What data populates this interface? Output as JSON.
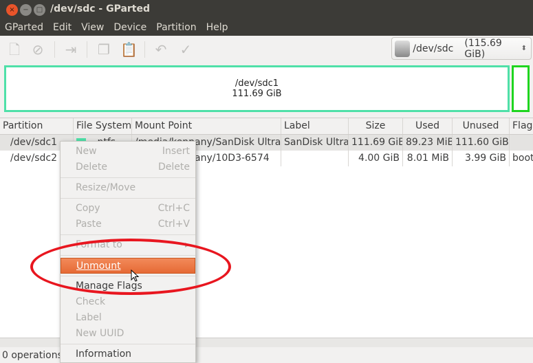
{
  "window": {
    "title": "/dev/sdc - GParted"
  },
  "menubar": [
    "GParted",
    "Edit",
    "View",
    "Device",
    "Partition",
    "Help"
  ],
  "device_selector": {
    "device": "/dev/sdc",
    "size": "(115.69 GiB)"
  },
  "graph": {
    "partition": "/dev/sdc1",
    "size": "111.69 GiB",
    "colors": {
      "ntfs": "#4fe0a8",
      "unallocated_or_sdc2": "#1fd51f"
    }
  },
  "table": {
    "headers": [
      "Partition",
      "File System",
      "Mount Point",
      "Label",
      "Size",
      "Used",
      "Unused",
      "Flags"
    ],
    "rows": [
      {
        "partition": "/dev/sdc1",
        "fs": "ntfs",
        "mount": "/media/kenpany/SanDisk Ultra",
        "label": "SanDisk Ultra",
        "size": "111.69 GiB",
        "used": "89.23 MiB",
        "unused": "111.60 GiB",
        "flags": ""
      },
      {
        "partition": "/dev/sdc2",
        "fs": "",
        "mount": "/media/kenpany/10D3-6574",
        "label": "",
        "size": "4.00 GiB",
        "used": "8.01 MiB",
        "unused": "3.99 GiB",
        "flags": "boot"
      }
    ]
  },
  "status": "0 operations pending",
  "context_menu": {
    "new": "New",
    "new_key": "Insert",
    "delete": "Delete",
    "delete_key": "Delete",
    "resize": "Resize/Move",
    "copy": "Copy",
    "copy_key": "Ctrl+C",
    "paste": "Paste",
    "paste_key": "Ctrl+V",
    "format": "Format to",
    "unmount": "Unmount",
    "flags": "Manage Flags",
    "check": "Check",
    "label": "Label",
    "uuid": "New UUID",
    "info": "Information"
  },
  "highlight_color": "#e66a35",
  "annotation_color": "#e8161f"
}
